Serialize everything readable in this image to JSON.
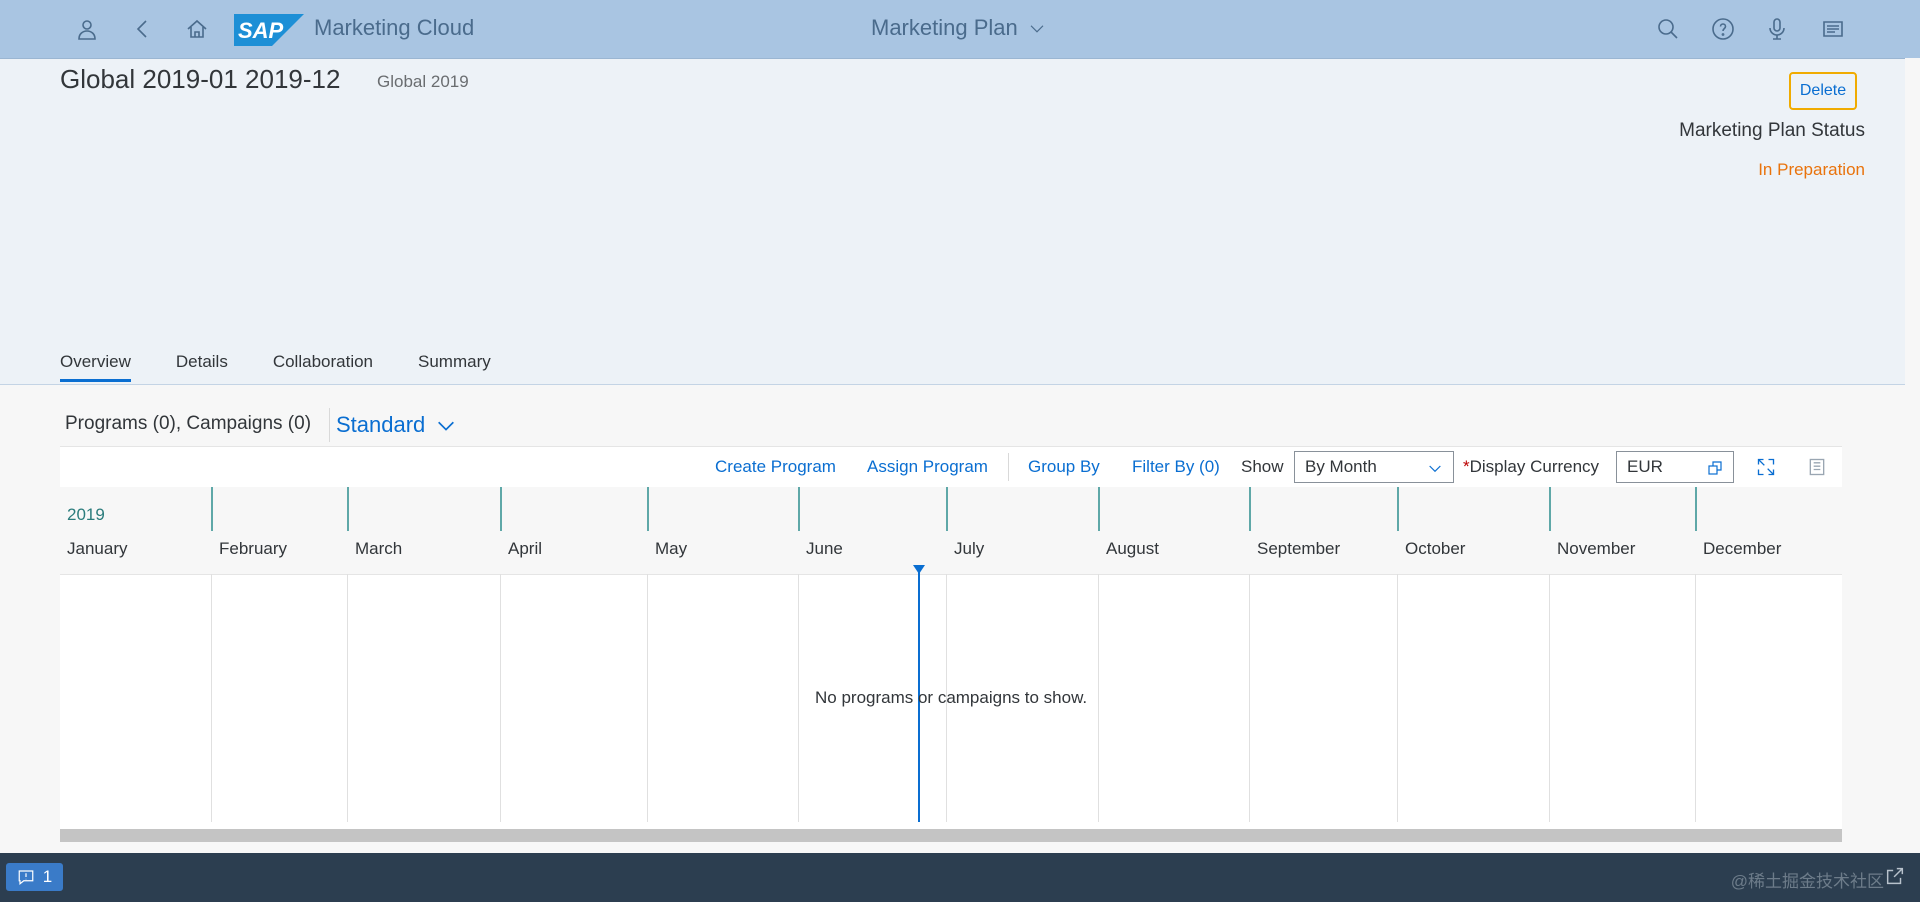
{
  "shell": {
    "app_name": "Marketing Cloud",
    "title": "Marketing Plan",
    "logo_text": "SAP"
  },
  "header": {
    "title": "Global 2019-01 2019-12",
    "subtitle": "Global 2019",
    "delete_label": "Delete",
    "status_label": "Marketing Plan Status",
    "status_value": "In Preparation"
  },
  "tabs": [
    {
      "label": "Overview"
    },
    {
      "label": "Details"
    },
    {
      "label": "Collaboration"
    },
    {
      "label": "Summary"
    }
  ],
  "section": {
    "title": "Programs (0), Campaigns (0)",
    "variant": "Standard"
  },
  "toolbar": {
    "create_program": "Create Program",
    "assign_program": "Assign Program",
    "group_by": "Group By",
    "filter_by": "Filter By (0)",
    "show_label": "Show",
    "show_value": "By Month",
    "currency_required_mark": "*",
    "currency_label": "Display Currency",
    "currency_value": "EUR"
  },
  "timeline": {
    "year": "2019",
    "months": [
      "January",
      "February",
      "March",
      "April",
      "May",
      "June",
      "July",
      "August",
      "September",
      "October",
      "November",
      "December"
    ],
    "empty_message": "No programs or campaigns to show."
  },
  "footer": {
    "message_count": "1",
    "watermark": "@稀土掘金技术社区"
  },
  "colors": {
    "shell_bg": "#a9c5e2",
    "accent": "#0a6ed1",
    "status": "#e9730c",
    "highlight": "#f0ab00"
  }
}
